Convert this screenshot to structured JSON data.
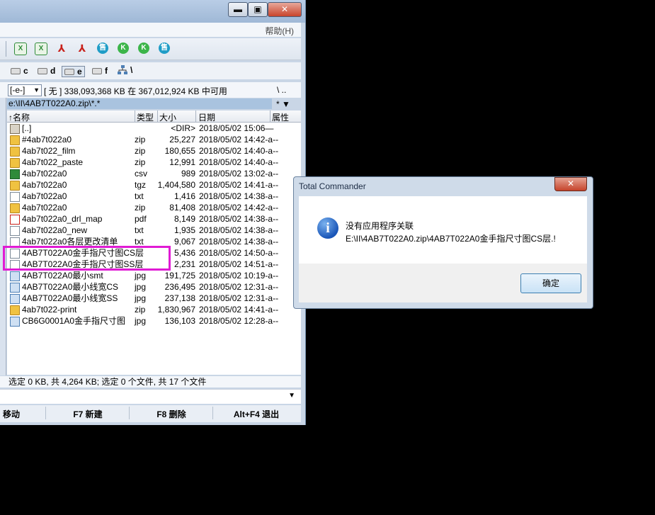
{
  "window": {
    "buttons": {
      "minimize": "▬",
      "maximize": "▣",
      "close": "✕"
    },
    "menu": {
      "help": "帮助(H)"
    },
    "toolbar_icons": [
      "excel-icon",
      "excel-icon",
      "pdf-icon",
      "pdf-icon",
      "teal-app-icon",
      "green-k-icon",
      "green-k-icon",
      "teal-app-icon"
    ],
    "drives": [
      "c",
      "d",
      "e",
      "f"
    ],
    "selected_drive": "e",
    "drive_select": "[-e-]",
    "drive_info": "[ 无 ]  338,093,368 KB 在 367,012,924 KB 中可用",
    "drive_info_right": "\\   ..",
    "path": "e:\\II\\4AB7T022A0.zip\\*.*",
    "path_right": "*   ▼",
    "columns": {
      "name": "↑名称",
      "type": "类型",
      "size": "大小",
      "date": "日期",
      "attr": "属性"
    },
    "files": [
      {
        "name": "[..]",
        "type": "",
        "size": "<DIR>",
        "date": "2018/05/02 15:06—",
        "icon": "up"
      },
      {
        "name": "#4ab7t022a0",
        "type": "zip",
        "size": "25,227",
        "date": "2018/05/02 14:42-a--",
        "icon": "folder"
      },
      {
        "name": "4ab7t022_film",
        "type": "zip",
        "size": "180,655",
        "date": "2018/05/02 14:40-a--",
        "icon": "folder"
      },
      {
        "name": "4ab7t022_paste",
        "type": "zip",
        "size": "12,991",
        "date": "2018/05/02 14:40-a--",
        "icon": "folder"
      },
      {
        "name": "4ab7t022a0",
        "type": "csv",
        "size": "989",
        "date": "2018/05/02 13:02-a--",
        "icon": "csvi"
      },
      {
        "name": "4ab7t022a0",
        "type": "tgz",
        "size": "1,404,580",
        "date": "2018/05/02 14:41-a--",
        "icon": "folder"
      },
      {
        "name": "4ab7t022a0",
        "type": "txt",
        "size": "1,416",
        "date": "2018/05/02 14:38-a--",
        "icon": "doc"
      },
      {
        "name": "4ab7t022a0",
        "type": "zip",
        "size": "81,408",
        "date": "2018/05/02 14:42-a--",
        "icon": "folder"
      },
      {
        "name": "4ab7t022a0_drl_map",
        "type": "pdf",
        "size": "8,149",
        "date": "2018/05/02 14:38-a--",
        "icon": "pdfi"
      },
      {
        "name": "4ab7t022a0_new",
        "type": "txt",
        "size": "1,935",
        "date": "2018/05/02 14:38-a--",
        "icon": "doc"
      },
      {
        "name": "4ab7t022a0各层更改清单",
        "type": "txt",
        "size": "9,067",
        "date": "2018/05/02 14:38-a--",
        "icon": "doc"
      },
      {
        "name": "4AB7T022A0金手指尺寸图CS层",
        "type": "",
        "size": "5,436",
        "date": "2018/05/02 14:50-a--",
        "icon": "doc"
      },
      {
        "name": "4AB7T022A0金手指尺寸图SS层",
        "type": "",
        "size": "2,231",
        "date": "2018/05/02 14:51-a--",
        "icon": "doc"
      },
      {
        "name": "4AB7T022A0最小smt",
        "type": "jpg",
        "size": "191,725",
        "date": "2018/05/02 10:19-a--",
        "icon": "jpgi"
      },
      {
        "name": "4AB7T022A0最小线宽CS",
        "type": "jpg",
        "size": "236,495",
        "date": "2018/05/02 12:31-a--",
        "icon": "jpgi"
      },
      {
        "name": "4AB7T022A0最小线宽SS",
        "type": "jpg",
        "size": "237,138",
        "date": "2018/05/02 12:31-a--",
        "icon": "jpgi"
      },
      {
        "name": "4ab7t022-print",
        "type": "zip",
        "size": "1,830,967",
        "date": "2018/05/02 14:41-a--",
        "icon": "folder"
      },
      {
        "name": "CB6G0001A0金手指尺寸图",
        "type": "jpg",
        "size": "136,103",
        "date": "2018/05/02 12:28-a--",
        "icon": "jpgi"
      }
    ],
    "status": "选定 0 KB, 共 4,264 KB; 选定 0 个文件, 共 17 个文件",
    "cmd_arrow": "▼",
    "fkeys": [
      "移动",
      "F7 新建",
      "F8 删除",
      "Alt+F4 退出"
    ]
  },
  "dialog": {
    "title": "Total Commander",
    "close": "✕",
    "icon": "i",
    "message_line1": "没有应用程序关联",
    "message_line2": "E:\\II\\4AB7T022A0.zip\\4AB7T022A0金手指尺寸图CS层.!",
    "ok": "确定"
  },
  "colors": {
    "highlight": "#e01bd4",
    "path_bar": "#a9c3df"
  }
}
